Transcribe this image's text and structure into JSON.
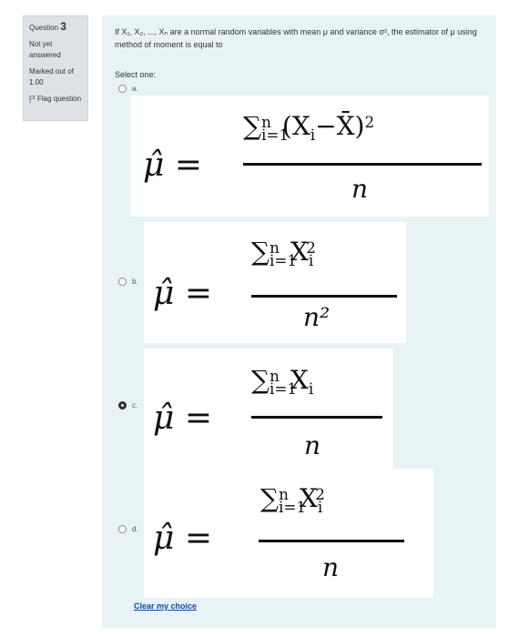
{
  "info": {
    "question_label": "Question",
    "question_number": "3",
    "status": "Not yet answered",
    "marks": "Marked out of 1.00",
    "flag_label": "Flag question"
  },
  "question": {
    "text": "If X₁, X₂, ..., Xₙ are a normal random variables with mean μ and variance σ², the estimator of μ using method of moment is equal to",
    "prompt": "Select one:"
  },
  "options": [
    {
      "letter": "a.",
      "checked": false,
      "lhs": "μ̂ =",
      "sum": "∑",
      "sum_sub": "i=1",
      "sum_sup": "n",
      "term": "(X",
      "term_sub": "i",
      "term_rest": "−X̄)",
      "term_sup": "2",
      "denominator": "n"
    },
    {
      "letter": "b.",
      "checked": false,
      "lhs": "μ̂ =",
      "sum": "∑",
      "sum_sub": "i=1",
      "sum_sup": "n",
      "term": "X",
      "term_sub": "i",
      "term_rest": "",
      "term_sup": "2",
      "denominator": "n²"
    },
    {
      "letter": "c.",
      "checked": true,
      "lhs": "μ̂ =",
      "sum": "∑",
      "sum_sub": "i=1",
      "sum_sup": "n",
      "term": "X",
      "term_sub": "i",
      "term_rest": "",
      "term_sup": "",
      "denominator": "n"
    },
    {
      "letter": "d.",
      "checked": false,
      "lhs": "μ̂ =",
      "sum": "∑",
      "sum_sub": "i=1",
      "sum_sup": "n",
      "term": "X",
      "term_sub": "i",
      "term_rest": "",
      "term_sup": "2",
      "denominator": "n"
    }
  ],
  "clear_label": "Clear my choice",
  "colors": {
    "panel_bg": "#e7f3f5",
    "info_bg": "#dee2e6",
    "link": "#0f47ad"
  }
}
